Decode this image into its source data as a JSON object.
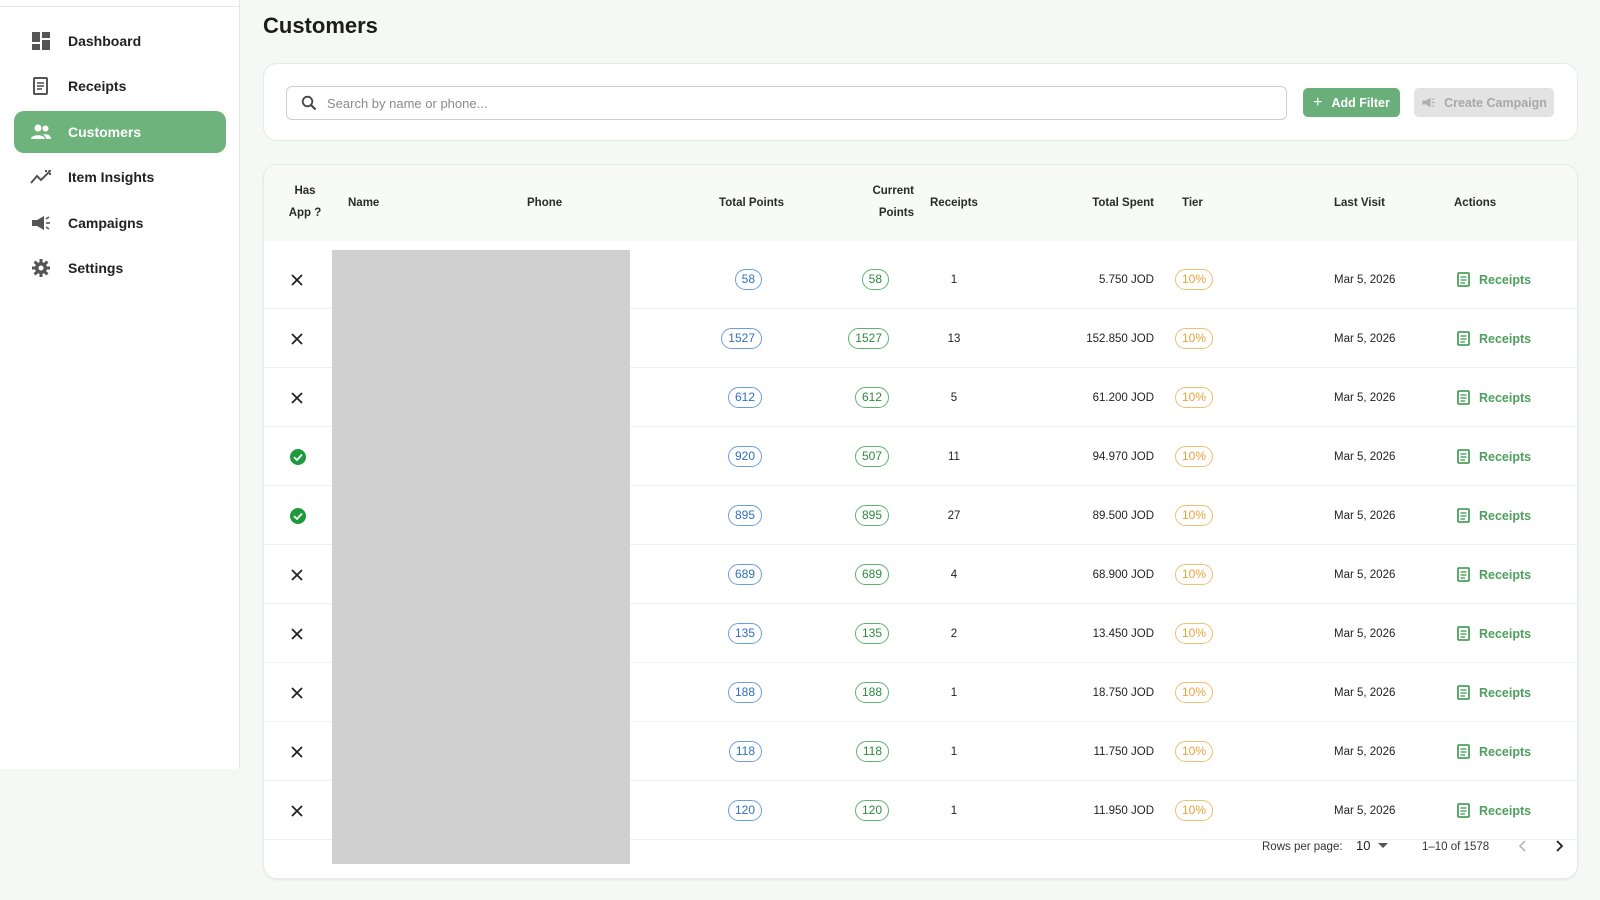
{
  "sidebar": {
    "items": [
      {
        "label": "Dashboard",
        "icon": "dashboard-icon"
      },
      {
        "label": "Receipts",
        "icon": "receipt-icon"
      },
      {
        "label": "Customers",
        "icon": "people-icon",
        "active": true
      },
      {
        "label": "Item Insights",
        "icon": "trend-icon"
      },
      {
        "label": "Campaigns",
        "icon": "megaphone-icon"
      },
      {
        "label": "Settings",
        "icon": "gear-icon"
      }
    ]
  },
  "page": {
    "title": "Customers"
  },
  "filters": {
    "search_placeholder": "Search by name or phone...",
    "add_filter_label": "Add Filter",
    "create_campaign_label": "Create Campaign"
  },
  "table": {
    "headers": {
      "has_app": "Has App ?",
      "name": "Name",
      "phone": "Phone",
      "total_points": "Total Points",
      "current_points": "Current Points",
      "receipts": "Receipts",
      "total_spent": "Total Spent",
      "tier": "Tier",
      "last_visit": "Last Visit",
      "actions": "Actions"
    },
    "rows": [
      {
        "has_app": false,
        "total_points": "58",
        "current_points": "58",
        "receipts": "1",
        "total_spent": "5.750 JOD",
        "tier": "10%",
        "last_visit": "Mar 5, 2026",
        "action": "Receipts"
      },
      {
        "has_app": false,
        "total_points": "1527",
        "current_points": "1527",
        "receipts": "13",
        "total_spent": "152.850 JOD",
        "tier": "10%",
        "last_visit": "Mar 5, 2026",
        "action": "Receipts"
      },
      {
        "has_app": false,
        "total_points": "612",
        "current_points": "612",
        "receipts": "5",
        "total_spent": "61.200 JOD",
        "tier": "10%",
        "last_visit": "Mar 5, 2026",
        "action": "Receipts"
      },
      {
        "has_app": true,
        "total_points": "920",
        "current_points": "507",
        "receipts": "11",
        "total_spent": "94.970 JOD",
        "tier": "10%",
        "last_visit": "Mar 5, 2026",
        "action": "Receipts"
      },
      {
        "has_app": true,
        "total_points": "895",
        "current_points": "895",
        "receipts": "27",
        "total_spent": "89.500 JOD",
        "tier": "10%",
        "last_visit": "Mar 5, 2026",
        "action": "Receipts"
      },
      {
        "has_app": false,
        "total_points": "689",
        "current_points": "689",
        "receipts": "4",
        "total_spent": "68.900 JOD",
        "tier": "10%",
        "last_visit": "Mar 5, 2026",
        "action": "Receipts"
      },
      {
        "has_app": false,
        "total_points": "135",
        "current_points": "135",
        "receipts": "2",
        "total_spent": "13.450 JOD",
        "tier": "10%",
        "last_visit": "Mar 5, 2026",
        "action": "Receipts"
      },
      {
        "has_app": false,
        "total_points": "188",
        "current_points": "188",
        "receipts": "1",
        "total_spent": "18.750 JOD",
        "tier": "10%",
        "last_visit": "Mar 5, 2026",
        "action": "Receipts"
      },
      {
        "has_app": false,
        "total_points": "118",
        "current_points": "118",
        "receipts": "1",
        "total_spent": "11.750 JOD",
        "tier": "10%",
        "last_visit": "Mar 5, 2026",
        "action": "Receipts"
      },
      {
        "has_app": false,
        "total_points": "120",
        "current_points": "120",
        "receipts": "1",
        "total_spent": "11.950 JOD",
        "tier": "10%",
        "last_visit": "Mar 5, 2026",
        "action": "Receipts"
      }
    ]
  },
  "pagination": {
    "rows_per_page_label": "Rows per page:",
    "rows_per_page_value": "10",
    "range_label": "1–10 of 1578"
  },
  "colors": {
    "accent": "#6eb27c",
    "points_blue": "#2f6fc4",
    "points_green": "#2c8a3e",
    "tier_orange": "#e8a23a",
    "has_app_check": "#1e9a3c"
  }
}
